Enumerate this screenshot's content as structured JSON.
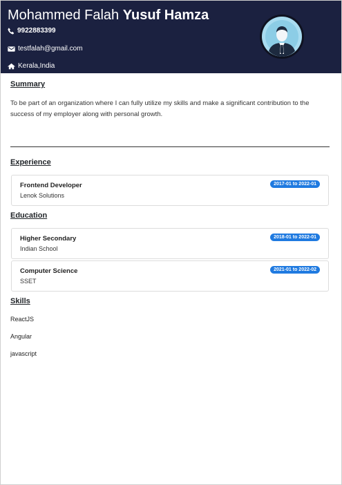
{
  "header": {
    "first_name": "Mohammed Falah",
    "last_name": "Yusuf Hamza",
    "phone": "9922883399",
    "email": "testfalah@gmail.com",
    "location": "Kerala,India",
    "icons": {
      "phone": "phone-icon",
      "email": "email-icon",
      "location": "home-icon",
      "avatar": "user-avatar"
    },
    "background_color": "#1b2140"
  },
  "summary": {
    "title": "Summary",
    "text": "To be part of an organization where I can fully utilize my skills and make a significant contribution to the success of my employer along with personal growth."
  },
  "experience": {
    "title": "Experience",
    "items": [
      {
        "role": "Frontend Developer",
        "company": "Lenok Solutions",
        "dates": "2017-01 to 2022-01"
      }
    ]
  },
  "education": {
    "title": "Education",
    "items": [
      {
        "degree": "Higher Secondary",
        "school": "Indian School",
        "dates": "2018-01 to 2022-01"
      },
      {
        "degree": "Computer Science",
        "school": "SSET",
        "dates": "2021-01 to 2022-02"
      }
    ]
  },
  "skills": {
    "title": "Skills",
    "items": [
      "ReactJS",
      "Angular",
      "javascript"
    ]
  },
  "colors": {
    "badge": "#1f7ae0",
    "header": "#1b2140"
  }
}
